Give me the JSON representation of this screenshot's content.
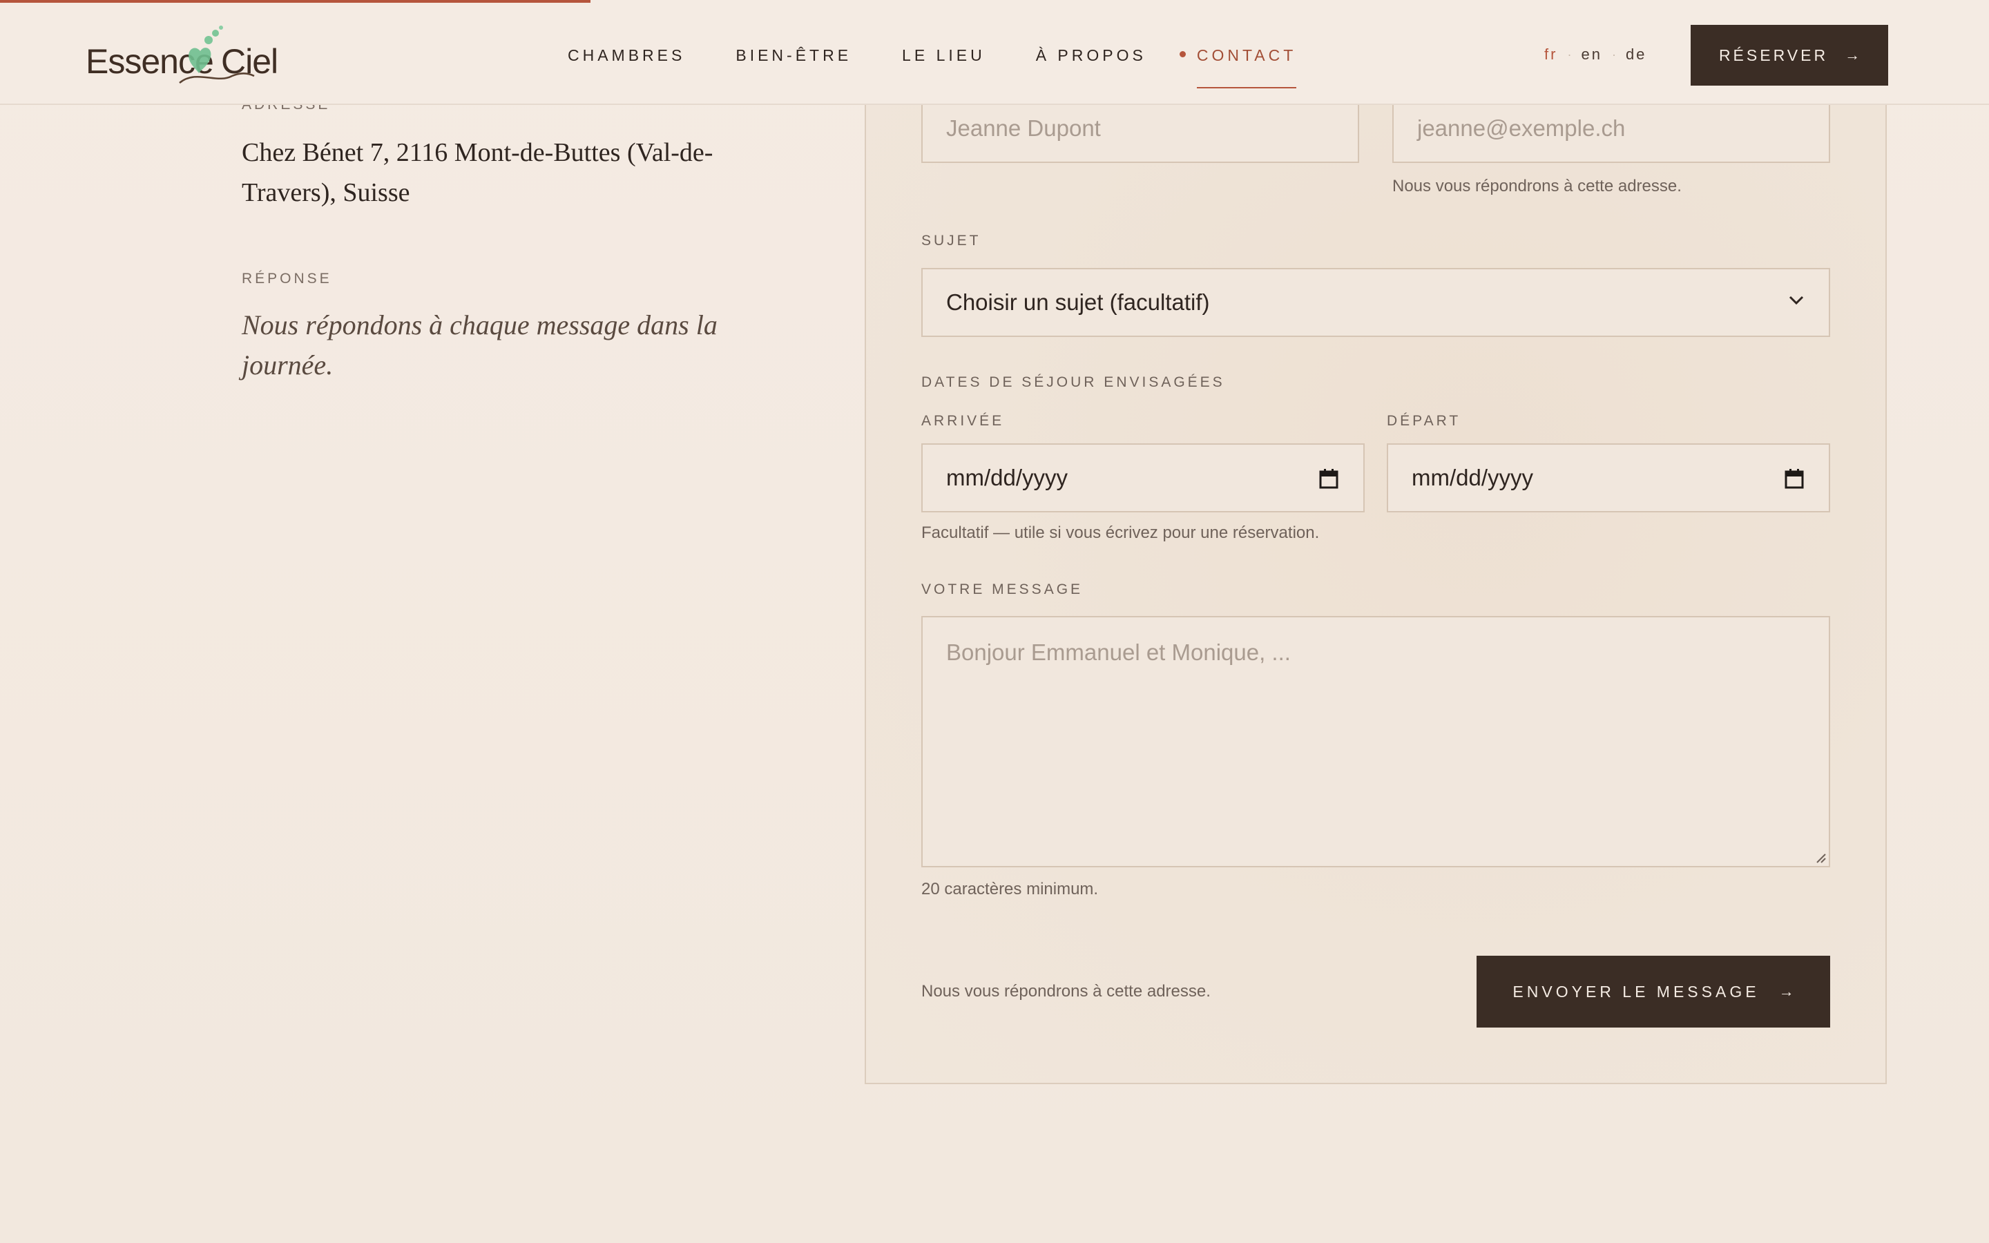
{
  "header": {
    "logo": {
      "left": "Essence",
      "right": "Ciel"
    },
    "nav": [
      {
        "label": "CHAMBRES"
      },
      {
        "label": "BIEN-ÊTRE"
      },
      {
        "label": "LE LIEU"
      },
      {
        "label": "À PROPOS"
      },
      {
        "label": "CONTACT",
        "active": true
      }
    ],
    "languages": [
      "fr",
      "en",
      "de"
    ],
    "active_language": "fr",
    "reserve_label": "RÉSERVER",
    "reserve_arrow": "→"
  },
  "info": {
    "address_label": "ADRESSE",
    "address_text": "Chez Bénet 7, 2116 Mont-de-Buttes (Val-de-Travers), Suisse",
    "response_label": "RÉPONSE",
    "response_text": "Nous répondons à chaque message dans la journée."
  },
  "form": {
    "name_placeholder": "Jeanne Dupont",
    "email_placeholder": "jeanne@exemple.ch",
    "email_hint": "Nous vous répondrons à cette adresse.",
    "subject_label": "SUJET",
    "subject_value": "Choisir un sujet (facultatif)",
    "dates_label": "DATES DE SÉJOUR ENVISAGÉES",
    "arrival_label": "ARRIVÉE",
    "arrival_value": "mm/dd/yyyy",
    "departure_label": "DÉPART",
    "departure_value": "mm/dd/yyyy",
    "dates_hint": "Facultatif — utile si vous écrivez pour une réservation.",
    "message_label": "VOTRE MESSAGE",
    "message_placeholder": "Bonjour Emmanuel et Monique, ...",
    "message_hint": "20 caractères minimum.",
    "footer_note": "Nous vous répondrons à cette adresse.",
    "submit_label": "ENVOYER LE MESSAGE",
    "submit_arrow": "→"
  },
  "colors": {
    "background": "#f3e9e0",
    "accent": "#b5553c",
    "dark_button": "#3b2d25",
    "logo_leaf": "#6fbf8f"
  }
}
